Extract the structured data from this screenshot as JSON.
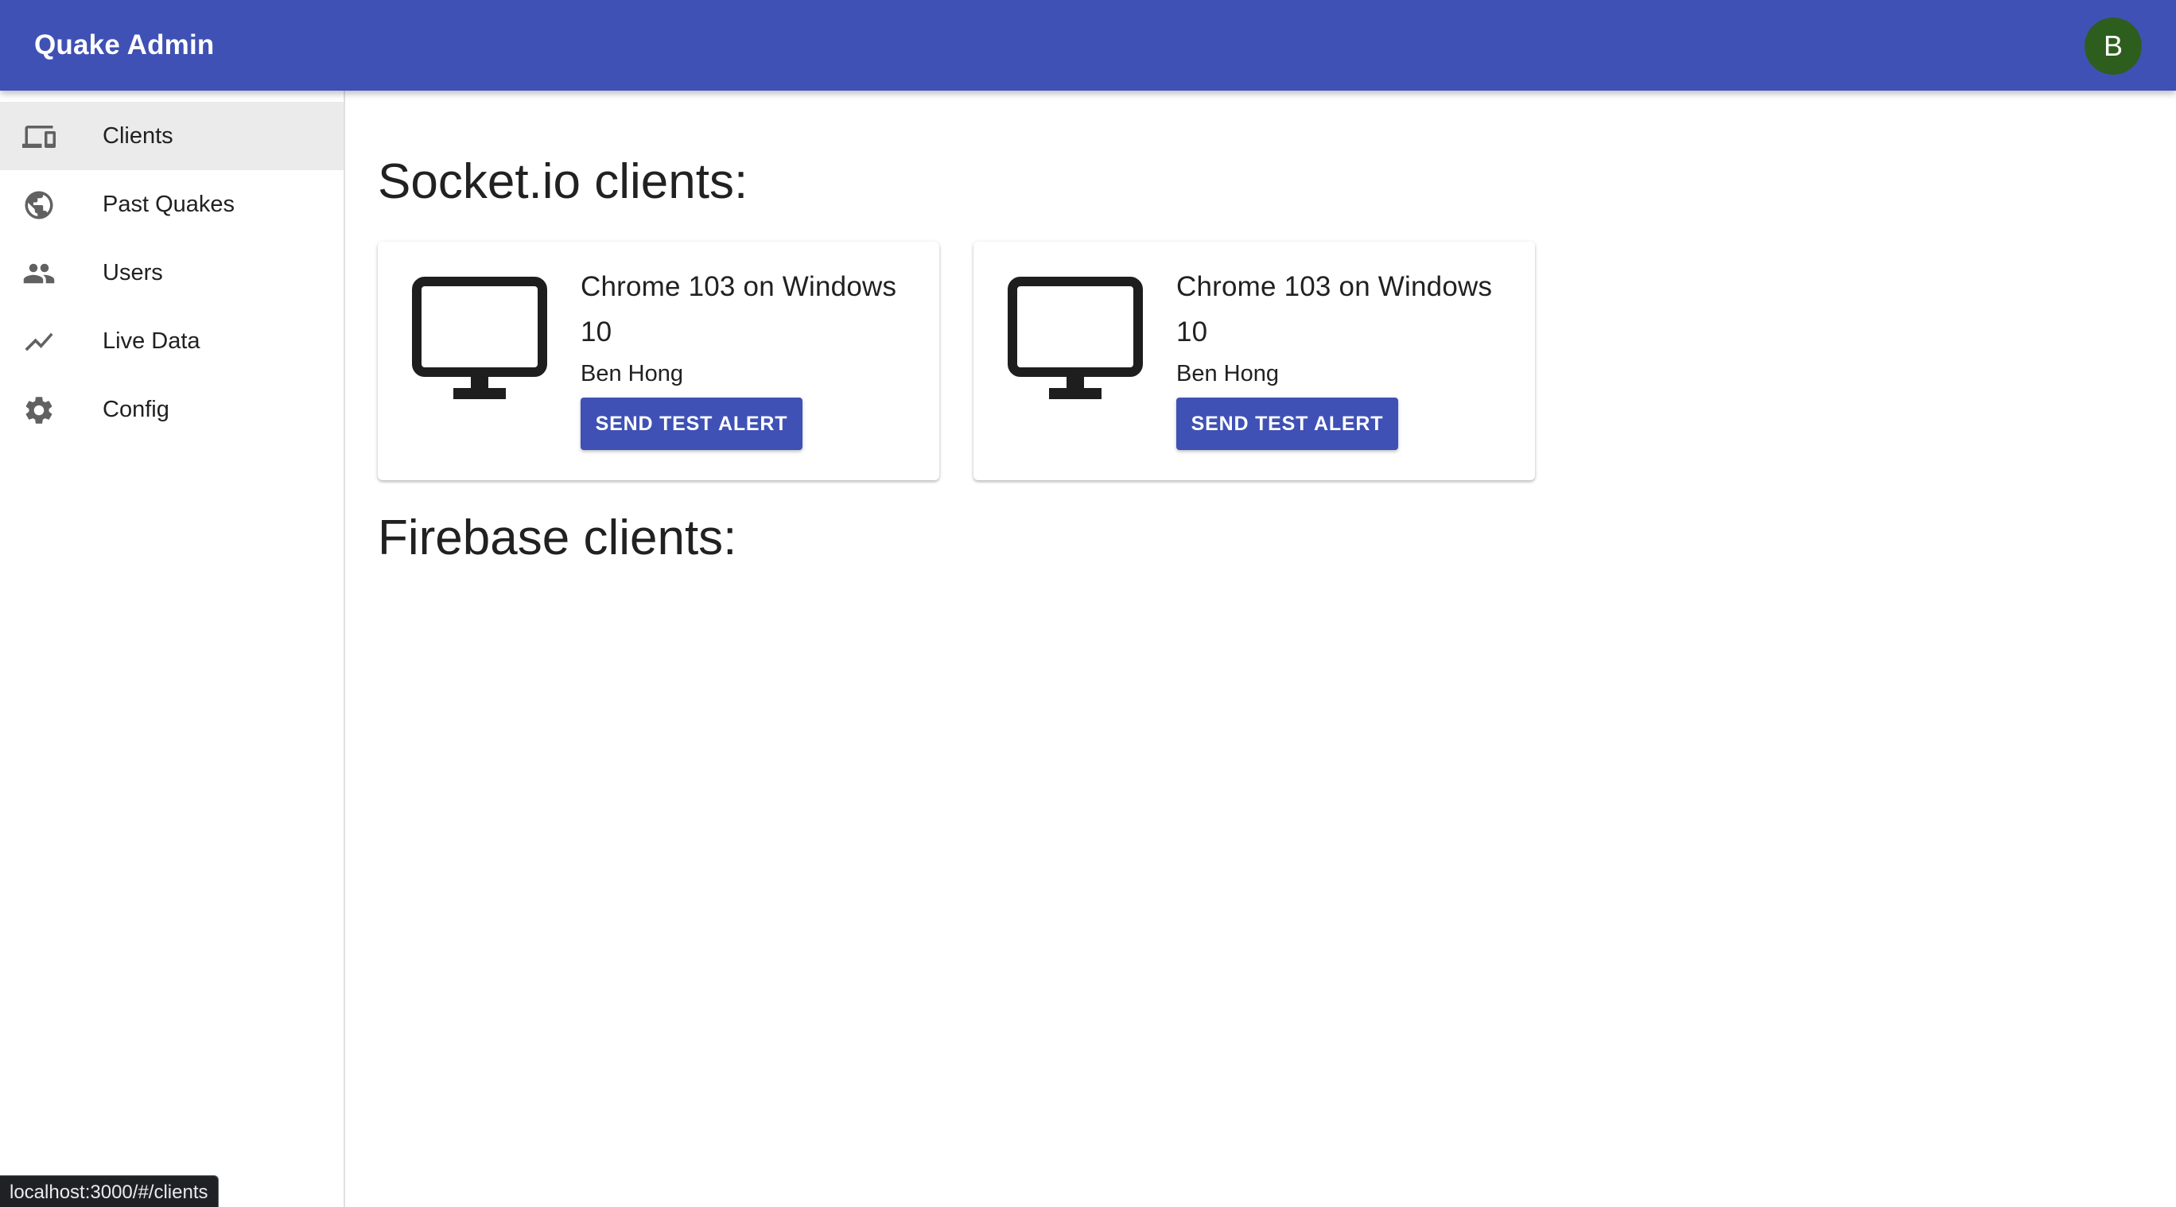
{
  "app": {
    "title": "Quake Admin",
    "avatar_letter": "B",
    "colors": {
      "primary": "#3f51b5",
      "avatar": "#2e5e1e",
      "active_nav_bg": "#ebebeb"
    }
  },
  "sidebar": {
    "items": [
      {
        "label": "Clients",
        "icon": "devices-icon",
        "active": true
      },
      {
        "label": "Past Quakes",
        "icon": "globe-icon",
        "active": false
      },
      {
        "label": "Users",
        "icon": "people-icon",
        "active": false
      },
      {
        "label": "Live Data",
        "icon": "trending-line-icon",
        "active": false
      },
      {
        "label": "Config",
        "icon": "gear-icon",
        "active": false
      }
    ]
  },
  "main": {
    "socket_title": "Socket.io clients:",
    "firebase_title": "Firebase clients:",
    "socket_clients": [
      {
        "device": "Chrome 103 on Windows 10",
        "user": "Ben Hong",
        "button_label": "Send test alert",
        "icon": "desktop-monitor-icon"
      },
      {
        "device": "Chrome 103 on Windows 10",
        "user": "Ben Hong",
        "button_label": "Send test alert",
        "icon": "desktop-monitor-icon"
      }
    ],
    "firebase_clients": []
  },
  "status_bar": {
    "url": "localhost:3000/#/clients"
  }
}
